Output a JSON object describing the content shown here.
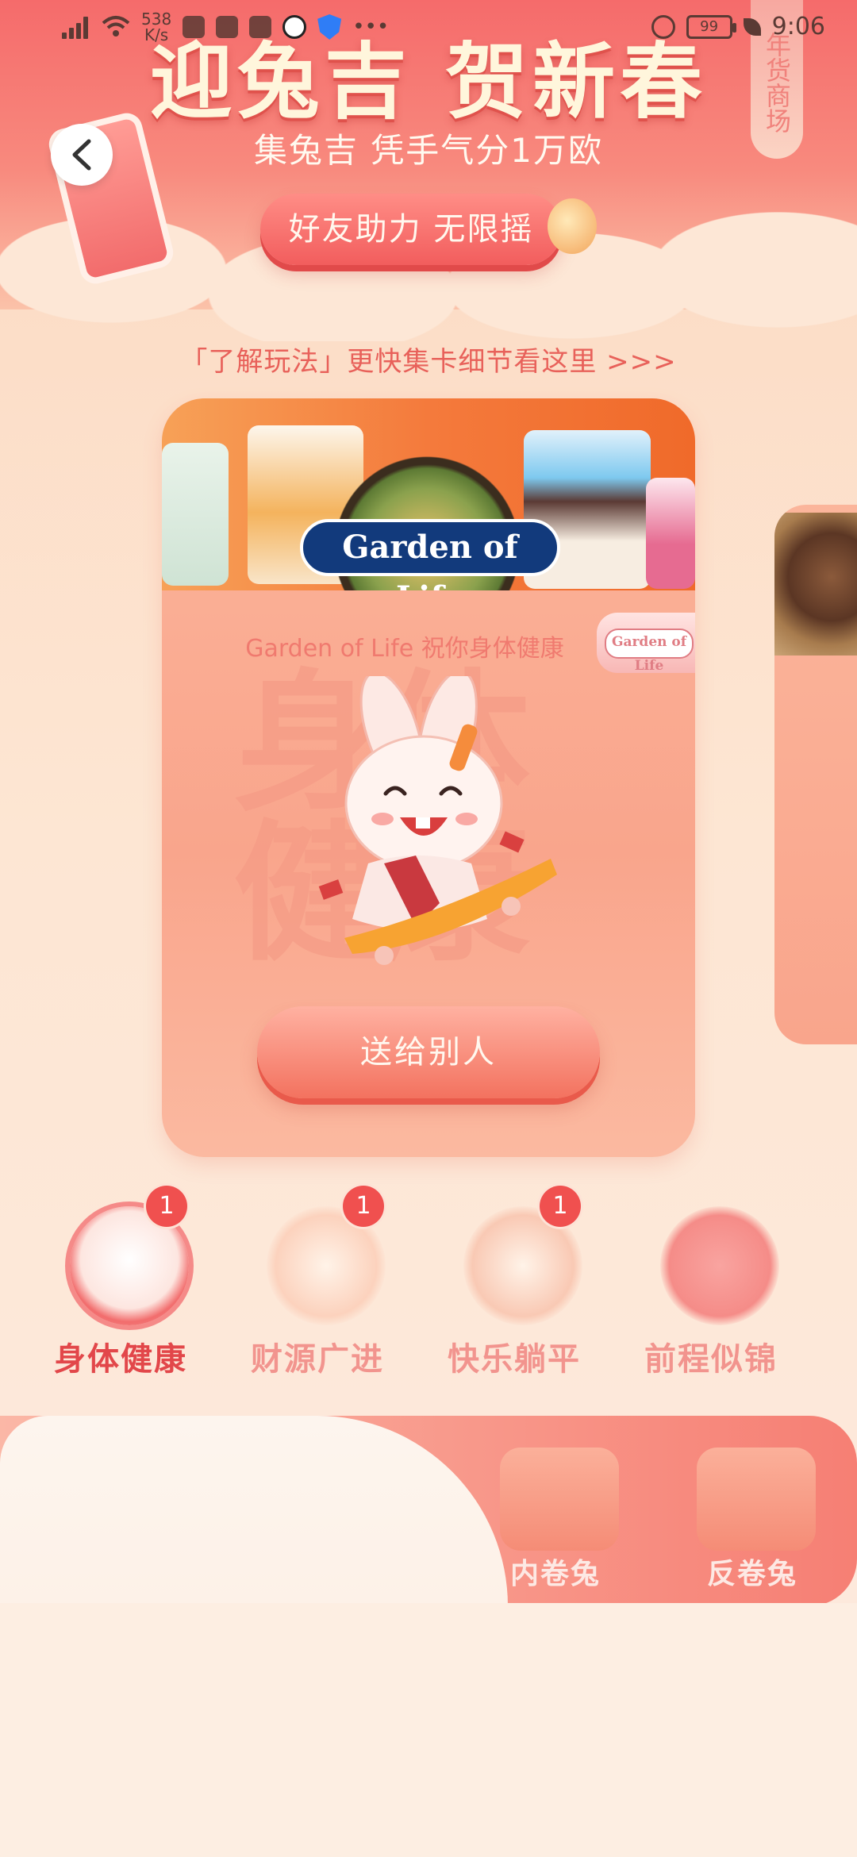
{
  "status_bar": {
    "net_speed_value": "538",
    "net_speed_unit": "K/s",
    "battery": "99",
    "time": "9:06"
  },
  "header": {
    "title": "迎兔吉 贺新春",
    "subtitle": "集兔吉 凭手气分1万欧",
    "share_button": "好友助力 无限摇",
    "side_tab": "年货商场"
  },
  "rules_link": "「了解玩法」更快集卡细节看这里 >>>",
  "card": {
    "brand_logo": "Garden of Life",
    "caption": "Garden of Life 祝你身体健康",
    "brand_tag": "Garden of Life",
    "watermark": "身体健康",
    "gift_button": "送给别人"
  },
  "wish_tabs": [
    {
      "label": "身体健康",
      "badge": "1"
    },
    {
      "label": "财源广进",
      "badge": "1"
    },
    {
      "label": "快乐躺平",
      "badge": "1"
    },
    {
      "label": "前程似锦",
      "badge": ""
    }
  ],
  "bottom": {
    "mode_1": "内卷兔",
    "mode_2": "反卷兔"
  },
  "colors": {
    "accent": "#f05a57",
    "active_label": "#e2474a",
    "inactive_label": "#f2948e",
    "brand_navy": "#123a7c"
  }
}
